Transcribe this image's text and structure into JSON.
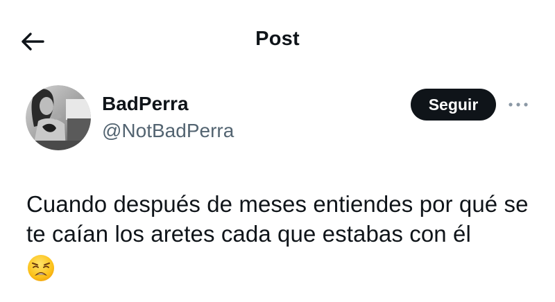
{
  "header": {
    "title": "Post",
    "back_icon": "arrow-left-icon"
  },
  "author": {
    "display_name": "BadPerra",
    "handle": "@NotBadPerra",
    "avatar_icon": "profile-photo"
  },
  "actions": {
    "follow_label": "Seguir",
    "more_icon": "more-horizontal-icon"
  },
  "post": {
    "text": "Cuando después de meses entiendes por qué se te caían los aretes cada que estabas con él",
    "emoji_icon": "weary-face-emoji"
  },
  "colors": {
    "text_primary": "#0f1419",
    "text_secondary": "#536471",
    "follow_bg": "#0f1419",
    "follow_text": "#ffffff",
    "background": "#ffffff"
  }
}
